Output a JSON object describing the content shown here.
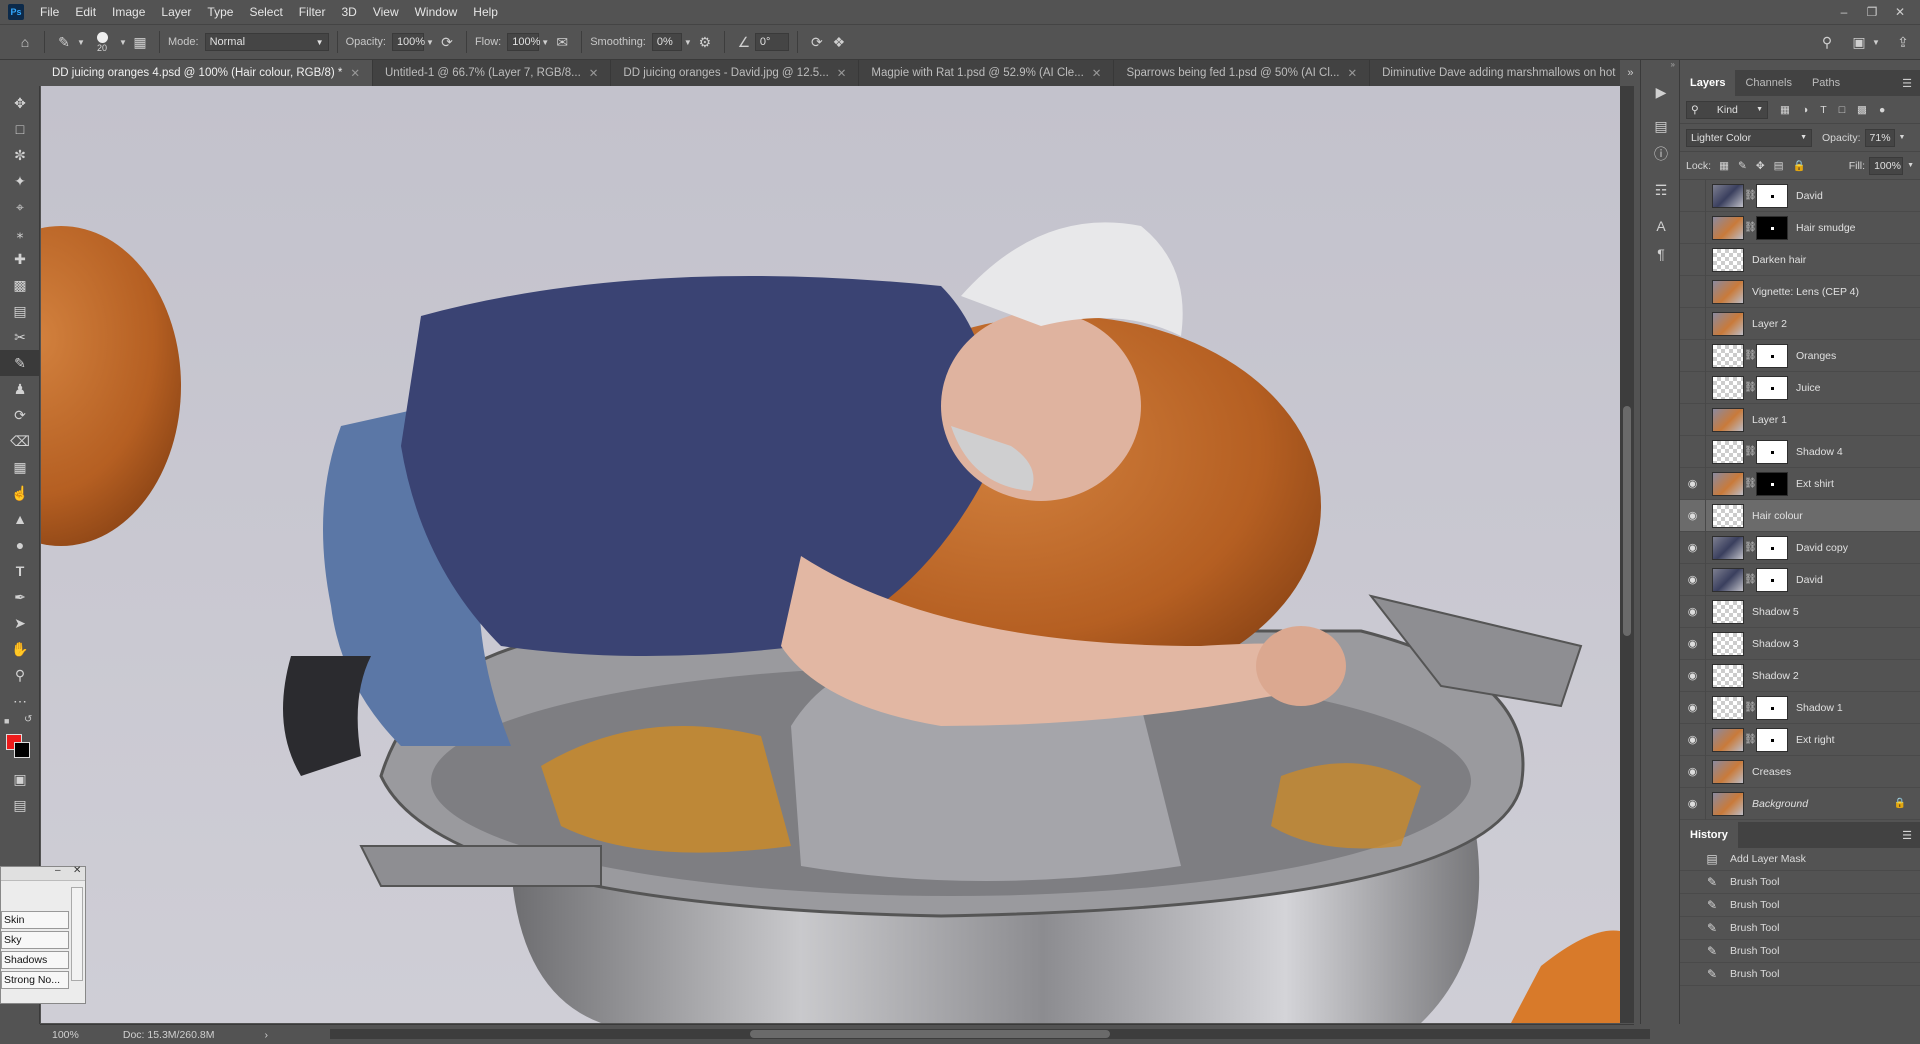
{
  "app": {
    "logo_text": "Ps"
  },
  "menubar": {
    "items": [
      "File",
      "Edit",
      "Image",
      "Layer",
      "Type",
      "Select",
      "Filter",
      "3D",
      "View",
      "Window",
      "Help"
    ]
  },
  "options_bar": {
    "brush_size": "20",
    "mode_label": "Mode:",
    "mode_value": "Normal",
    "opacity_label": "Opacity:",
    "opacity_value": "100%",
    "flow_label": "Flow:",
    "flow_value": "100%",
    "smoothing_label": "Smoothing:",
    "smoothing_value": "0%",
    "angle_value": "0°"
  },
  "doc_tabs": [
    {
      "label": "DD juicing oranges 4.psd @ 100% (Hair colour, RGB/8) *",
      "active": true
    },
    {
      "label": "Untitled-1 @ 66.7% (Layer 7, RGB/8...",
      "active": false
    },
    {
      "label": "DD juicing oranges - David.jpg @ 12.5...",
      "active": false
    },
    {
      "label": "Magpie with Rat 1.psd @ 52.9% (AI Cle...",
      "active": false
    },
    {
      "label": "Sparrows being fed 1.psd @ 50% (AI Cl...",
      "active": false
    },
    {
      "label": "Diminutive Dave adding marshmallows on hot",
      "active": false
    }
  ],
  "status": {
    "zoom": "100%",
    "doc": "Doc: 15.3M/260.8M"
  },
  "colors": {
    "foreground": "#ee1c1c",
    "background": "#000000"
  },
  "layers_panel": {
    "tabs": [
      "Layers",
      "Channels",
      "Paths"
    ],
    "filter_kind": "Kind",
    "blend_mode": "Lighter Color",
    "opacity_label": "Opacity:",
    "opacity_value": "71%",
    "lock_label": "Lock:",
    "fill_label": "Fill:",
    "fill_value": "100%",
    "layers": [
      {
        "name": "David",
        "visible": false,
        "mask": "white",
        "thumb": "photo2"
      },
      {
        "name": "Hair smudge",
        "visible": false,
        "mask": "black",
        "thumb": "photo"
      },
      {
        "name": "Darken hair",
        "visible": false,
        "mask": "",
        "thumb": "trans"
      },
      {
        "name": "Vignette: Lens (CEP 4)",
        "visible": false,
        "mask": "",
        "thumb": "photo"
      },
      {
        "name": "Layer 2",
        "visible": false,
        "mask": "",
        "thumb": "photo"
      },
      {
        "name": "Oranges",
        "visible": false,
        "mask": "white",
        "thumb": "trans"
      },
      {
        "name": "Juice",
        "visible": false,
        "mask": "white",
        "thumb": "trans"
      },
      {
        "name": "Layer 1",
        "visible": false,
        "mask": "",
        "thumb": "photo"
      },
      {
        "name": "Shadow 4",
        "visible": false,
        "mask": "white",
        "thumb": "trans"
      },
      {
        "name": "Ext shirt",
        "visible": true,
        "mask": "black",
        "thumb": "photo"
      },
      {
        "name": "Hair colour",
        "visible": true,
        "mask": "",
        "thumb": "trans",
        "selected": true
      },
      {
        "name": "David copy",
        "visible": true,
        "mask": "white",
        "thumb": "photo2"
      },
      {
        "name": "David",
        "visible": true,
        "mask": "white",
        "thumb": "photo2"
      },
      {
        "name": "Shadow 5",
        "visible": true,
        "mask": "",
        "thumb": "trans"
      },
      {
        "name": "Shadow 3",
        "visible": true,
        "mask": "",
        "thumb": "trans"
      },
      {
        "name": "Shadow 2",
        "visible": true,
        "mask": "",
        "thumb": "trans"
      },
      {
        "name": "Shadow 1",
        "visible": true,
        "mask": "white",
        "thumb": "trans"
      },
      {
        "name": "Ext right",
        "visible": true,
        "mask": "white",
        "thumb": "photo"
      },
      {
        "name": "Creases",
        "visible": true,
        "mask": "",
        "thumb": "photo"
      },
      {
        "name": "Background",
        "visible": true,
        "mask": "",
        "thumb": "photo",
        "locked": true,
        "italic": true
      }
    ]
  },
  "history_panel": {
    "title": "History",
    "items": [
      "Add Layer Mask",
      "Brush Tool",
      "Brush Tool",
      "Brush Tool",
      "Brush Tool",
      "Brush Tool"
    ]
  },
  "floating_panel": {
    "items": [
      "Skin",
      "Sky",
      "Shadows",
      "Strong No..."
    ]
  }
}
